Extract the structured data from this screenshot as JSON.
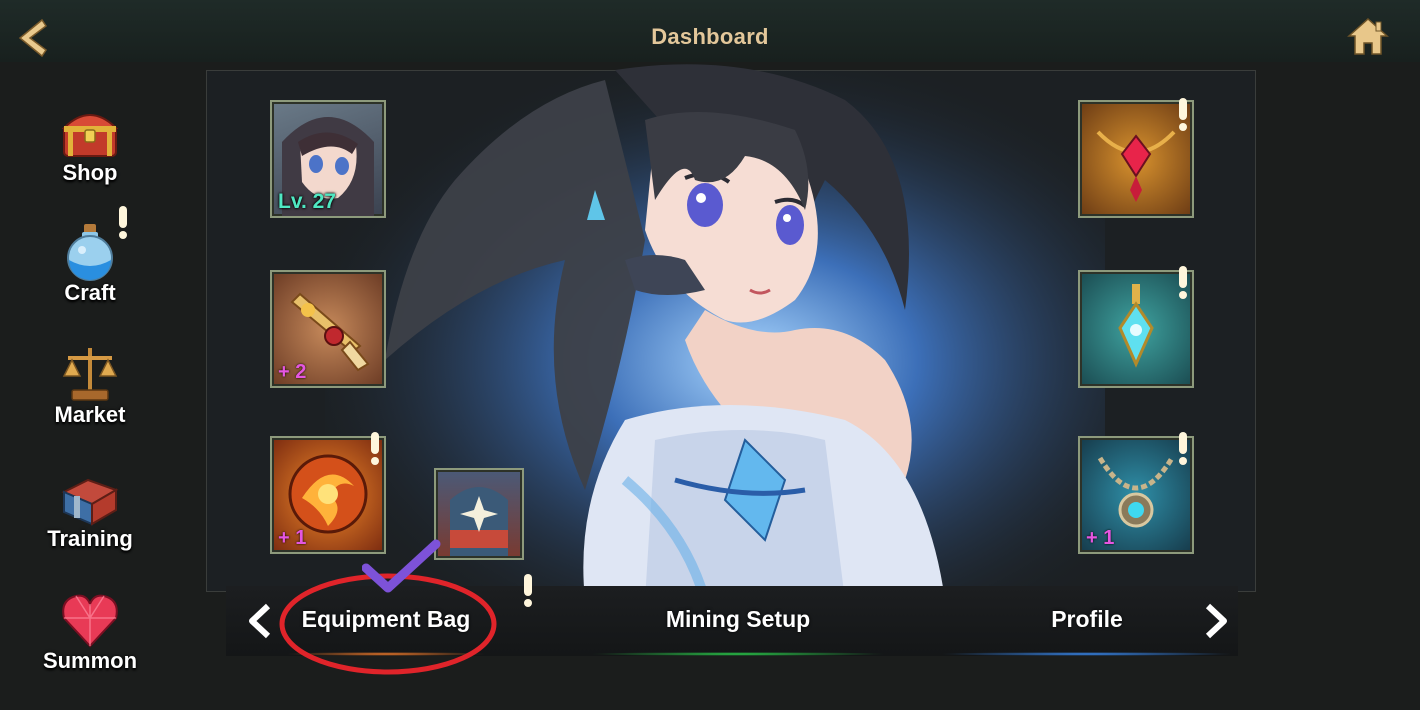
{
  "header": {
    "title": "Dashboard"
  },
  "sidebar": {
    "items": [
      {
        "label": "Shop",
        "icon": "treasure-chest-icon"
      },
      {
        "label": "Craft",
        "icon": "potion-flask-icon"
      },
      {
        "label": "Market",
        "icon": "scales-icon"
      },
      {
        "label": "Training",
        "icon": "training-chest-icon"
      },
      {
        "label": "Summon",
        "icon": "ruby-heart-icon"
      }
    ]
  },
  "character": {
    "level_text": "Lv. 27"
  },
  "slots": {
    "weapon_plus": "+ 2",
    "emblem_plus": "+ 1",
    "necklace_plus": "+ 1"
  },
  "tabs": [
    {
      "label": "Equipment Bag",
      "accent": "#f07a2a"
    },
    {
      "label": "Mining Setup",
      "accent": "#2bd24d"
    },
    {
      "label": "Profile",
      "accent": "#3a8cf5"
    }
  ],
  "colors": {
    "title": "#e3c79a",
    "level": "#4fe8c2",
    "plus": "#e556e0",
    "annotation_circle": "#e0242a",
    "annotation_check": "#7d52d8"
  }
}
